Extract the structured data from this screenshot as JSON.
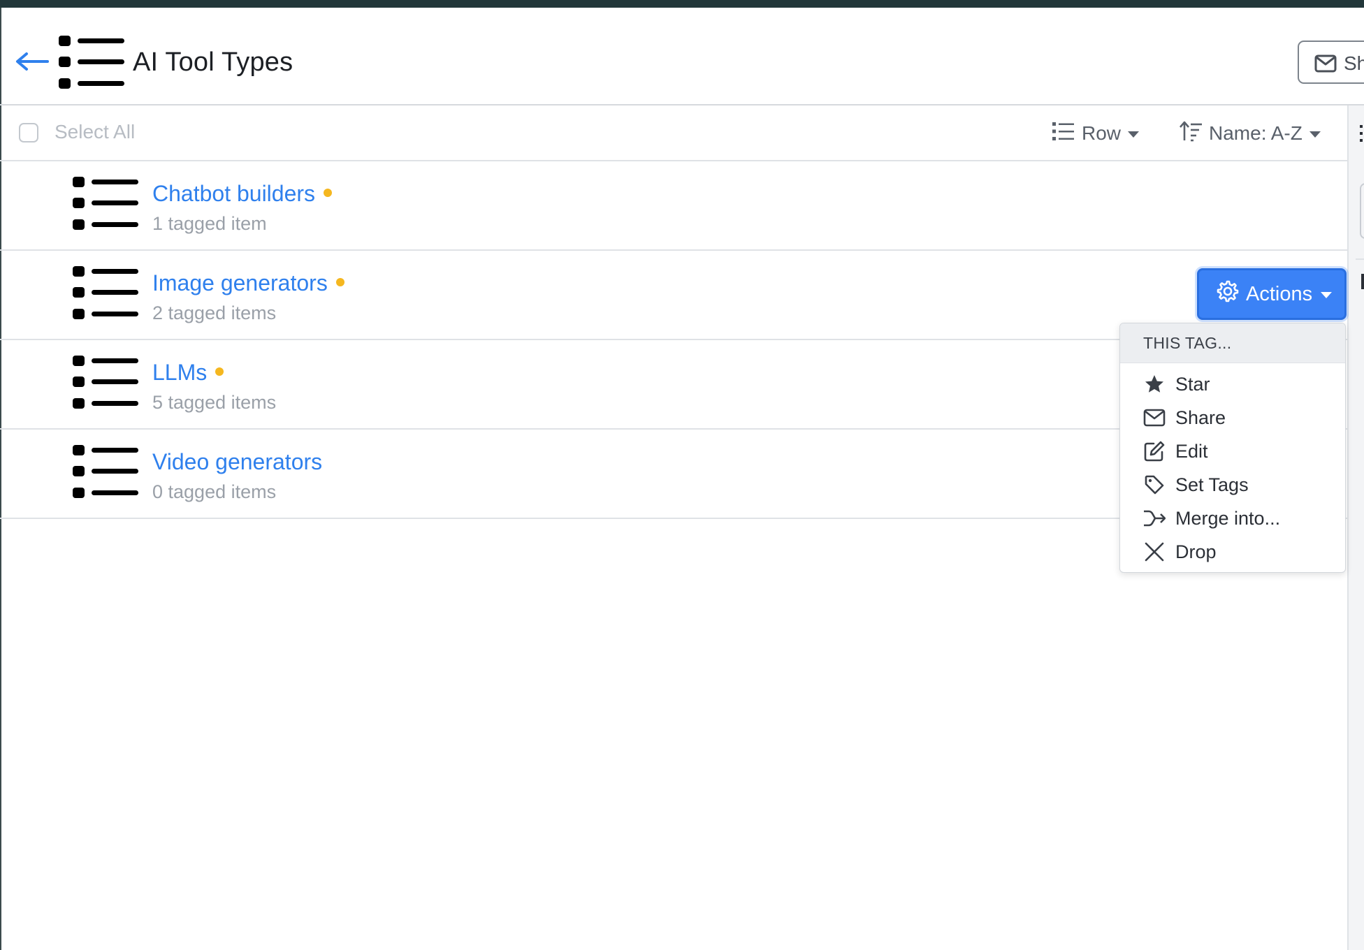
{
  "header": {
    "title": "AI Tool Types",
    "share_label": "Sh"
  },
  "toolbar": {
    "select_all_label": "Select All",
    "view_label": "Row",
    "sort_label": "Name: A-Z"
  },
  "tags": [
    {
      "name": "Chatbot builders",
      "count_text": "1 tagged item"
    },
    {
      "name": "Image generators",
      "count_text": "2 tagged items"
    },
    {
      "name": "LLMs",
      "count_text": "5 tagged items"
    },
    {
      "name": "Video generators",
      "count_text": "0 tagged items"
    }
  ],
  "actions": {
    "button_label": "Actions",
    "menu_header": "THIS TAG...",
    "items": [
      {
        "label": "Star",
        "icon": "star-icon"
      },
      {
        "label": "Share",
        "icon": "envelope-icon"
      },
      {
        "label": "Edit",
        "icon": "edit-icon"
      },
      {
        "label": "Set Tags",
        "icon": "tag-icon"
      },
      {
        "label": "Merge into...",
        "icon": "merge-icon"
      },
      {
        "label": "Drop",
        "icon": "close-icon"
      }
    ]
  },
  "colors": {
    "accent": "#2f80ed",
    "button_blue": "#3b82f6",
    "status_dot": "#f5b71f",
    "topbar": "#22373a"
  }
}
